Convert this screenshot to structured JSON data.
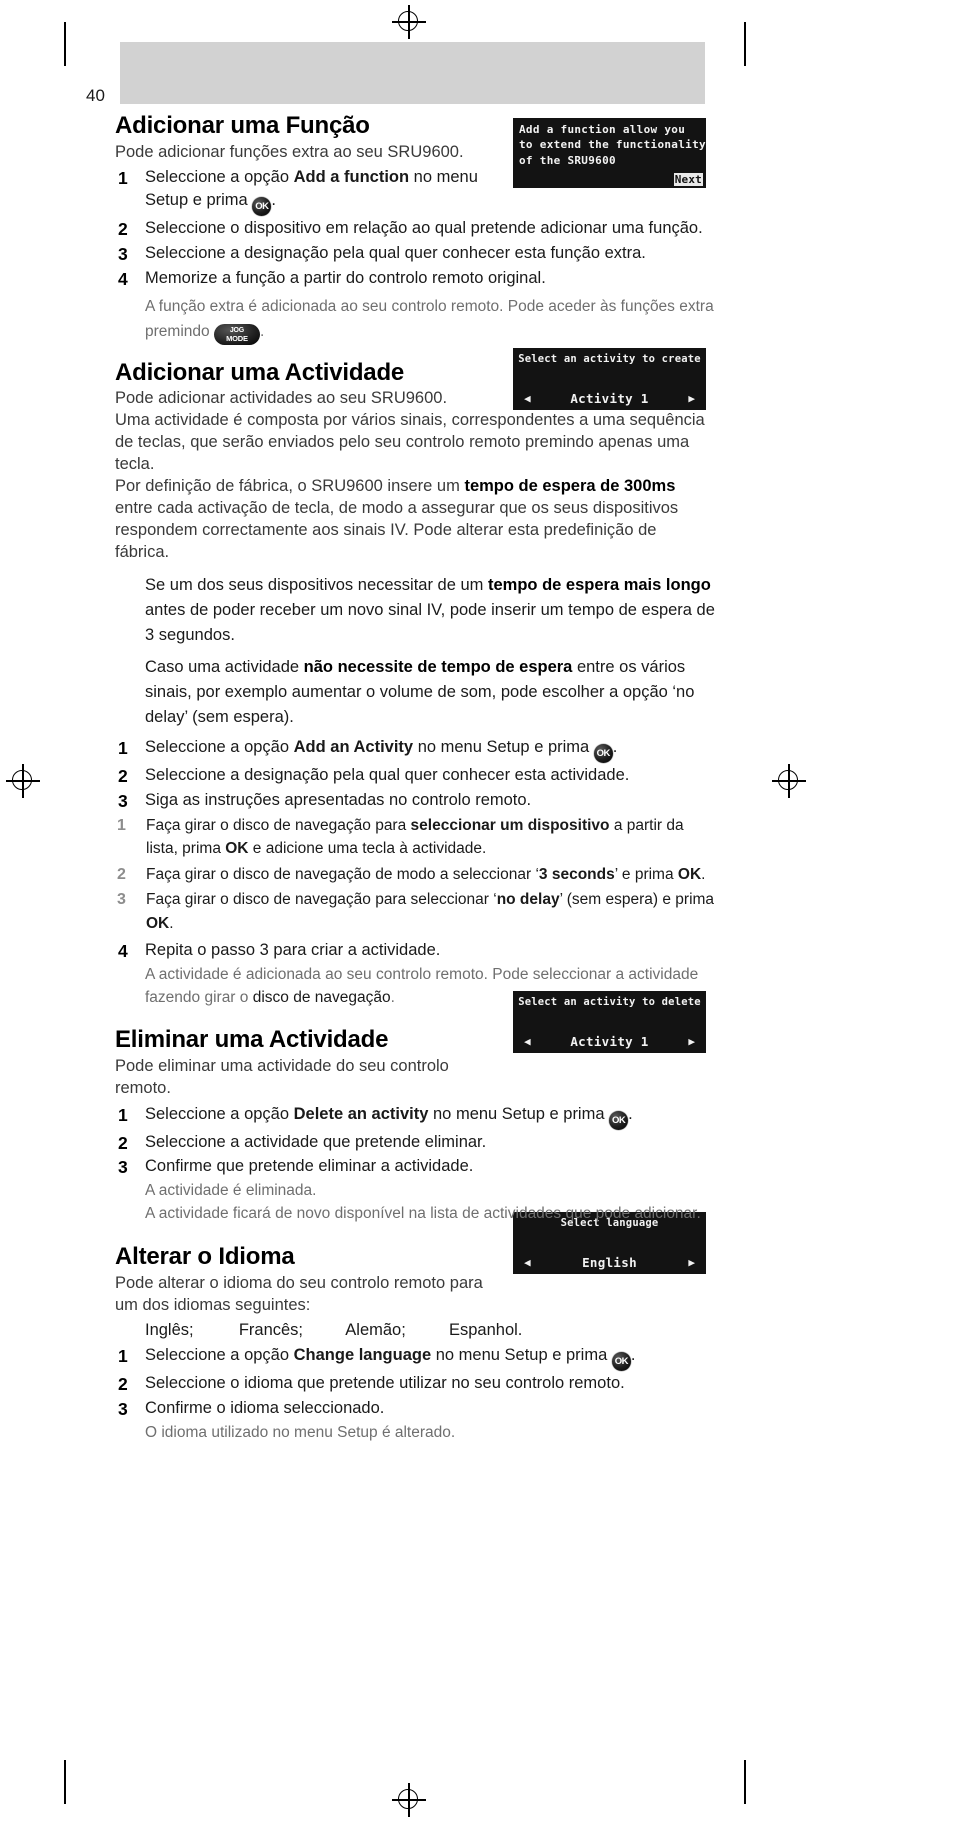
{
  "page": {
    "folio": "40"
  },
  "sections": [
    {
      "id": "add-function",
      "title": "Adicionar uma Função",
      "lead": "Pode adicionar funções extra ao seu SRU9600.",
      "steps": [
        {
          "num": "1",
          "html": "Seleccione a opção <b>Add a function</b> no menu Setup e prima <span class=\"okbtn\">OK</span>."
        },
        {
          "num": "2",
          "html": "Seleccione o dispositivo em relação ao qual pretende adicionar uma função."
        },
        {
          "num": "3",
          "html": "Seleccione a designação pela qual quer conhecer esta função extra."
        },
        {
          "num": "4",
          "html": "Memorize a função a partir do controlo remoto original."
        }
      ],
      "note": "A função extra é adicionada ao seu controlo remoto. Pode aceder às funções extra premindo <span class=\"jogbtn\"><span class=\"l1\">JOG</span><span class=\"l2\">MODE</span></span>.",
      "lcd": {
        "type": "text",
        "lines": [
          "Add a function allow you",
          "to extend the functionality",
          "of the SRU9600"
        ],
        "button": "Next"
      }
    },
    {
      "id": "add-activity",
      "title": "Adicionar uma Actividade",
      "lead": "Pode adicionar actividades ao seu SRU9600.",
      "paras": [
        "Uma actividade é composta por vários sinais, correspondentes a uma sequência de teclas, que serão enviados pelo seu controlo remoto premindo apenas uma tecla.",
        "Por definição de fábrica, o SRU9600 insere um <b>tempo de espera de 300ms</b> entre cada activação de tecla, de modo a assegurar que os seus dispositivos respondem correctamente aos sinais IV. Pode alterar esta predefinição de fábrica."
      ],
      "indented_paras": [
        "Se um dos seus dispositivos necessitar de um <b>tempo de espera mais longo</b> antes de poder receber um novo sinal IV, pode inserir um tempo de espera de 3 segundos.",
        "Caso uma actividade <b>não necessite de tempo de espera</b> entre os vários sinais, por exemplo aumentar o volume de som, pode escolher a opção ‘no delay’ (sem espera)."
      ],
      "steps": [
        {
          "num": "1",
          "html": "Seleccione a opção <b>Add an Activity</b> no menu Setup e prima <span class=\"okbtn\">OK</span>."
        },
        {
          "num": "2",
          "html": "Seleccione a designação pela qual quer conhecer esta actividade."
        },
        {
          "num": "3",
          "html": "Siga as instruções apresentadas no controlo remoto."
        }
      ],
      "substeps": [
        {
          "num": "1",
          "html": "Faça girar o disco de navegação para <b>seleccionar um dispositivo</b> a partir da lista, prima <b>OK</b> e adicione uma tecla à actividade."
        },
        {
          "num": "2",
          "html": "Faça girar o disco de navegação de modo a seleccionar ‘<b>3 seconds</b>’ e prima <b>OK</b>."
        },
        {
          "num": "3",
          "html": "Faça girar o disco de navegação para seleccionar ‘<b>no delay</b>’ (sem espera) e prima <b>OK</b>."
        }
      ],
      "final_step": {
        "num": "4",
        "html": "Repita o passo 3 para criar a actividade."
      },
      "note": "A actividade é adicionada ao seu controlo remoto. Pode seleccionar a actividade fazendo girar o <span style=\"color:#1a1a1a\">disco de navegação</span>.",
      "lcd": {
        "type": "select",
        "title": "Select an activity to create",
        "value": "Activity 1",
        "left_arrow": "◀",
        "right_arrow": "▶"
      }
    },
    {
      "id": "delete-activity",
      "title": "Eliminar uma Actividade",
      "lead": "Pode eliminar uma actividade do seu controlo remoto.",
      "steps": [
        {
          "num": "1",
          "html": "Seleccione a opção <b>Delete an activity</b> no menu Setup e prima <span class=\"okbtn\">OK</span>."
        },
        {
          "num": "2",
          "html": "Seleccione a actividade que pretende eliminar."
        },
        {
          "num": "3",
          "html": "Confirme que pretende eliminar a actividade."
        }
      ],
      "notes": [
        "A actividade é eliminada.",
        "A actividade ficará de novo disponível na lista de actividades que pode adicionar."
      ],
      "lcd": {
        "type": "select",
        "title": "Select an activity to delete",
        "value": "Activity 1",
        "left_arrow": "◀",
        "right_arrow": "▶"
      }
    },
    {
      "id": "change-language",
      "title": "Alterar o Idioma",
      "lead": "Pode alterar o idioma do seu controlo remoto para um dos idiomas seguintes:",
      "languages": [
        "Inglês;",
        "Francês;",
        "Alemão;",
        "Espanhol."
      ],
      "steps": [
        {
          "num": "1",
          "html": "Seleccione a opção <b>Change language</b> no menu Setup e prima <span class=\"okbtn\">OK</span>."
        },
        {
          "num": "2",
          "html": "Seleccione o idioma que pretende utilizar no seu controlo remoto."
        },
        {
          "num": "3",
          "html": "Confirme o idioma seleccionado."
        }
      ],
      "notes": [
        "O idioma utilizado no menu Setup é alterado."
      ],
      "lcd": {
        "type": "select",
        "title": "Select language",
        "value": "English",
        "left_arrow": "◀",
        "right_arrow": "▶"
      }
    }
  ]
}
